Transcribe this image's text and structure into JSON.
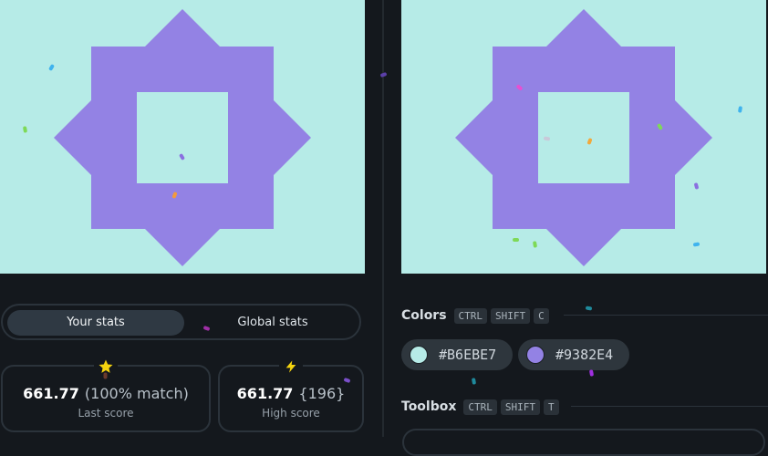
{
  "colors": {
    "background": "#B6EBE7",
    "shape": "#9382E4",
    "app_bg": "#14181d"
  },
  "stats": {
    "tabs": [
      {
        "label": "Your stats",
        "active": true
      },
      {
        "label": "Global stats",
        "active": false
      }
    ],
    "last_score": {
      "value": "661.77",
      "detail": "(100% match)",
      "label": "Last score",
      "icon": "star-icon"
    },
    "high_score": {
      "value": "661.77",
      "detail": "{196}",
      "label": "High score",
      "icon": "lightning-icon"
    }
  },
  "colors_section": {
    "title": "Colors",
    "shortcut": [
      "CTRL",
      "SHIFT",
      "C"
    ],
    "chips": [
      {
        "code": "#B6EBE7",
        "color": "#B6EBE7"
      },
      {
        "code": "#9382E4",
        "color": "#9382E4"
      }
    ]
  },
  "toolbox_section": {
    "title": "Toolbox",
    "shortcut": [
      "CTRL",
      "SHIFT",
      "T"
    ]
  }
}
